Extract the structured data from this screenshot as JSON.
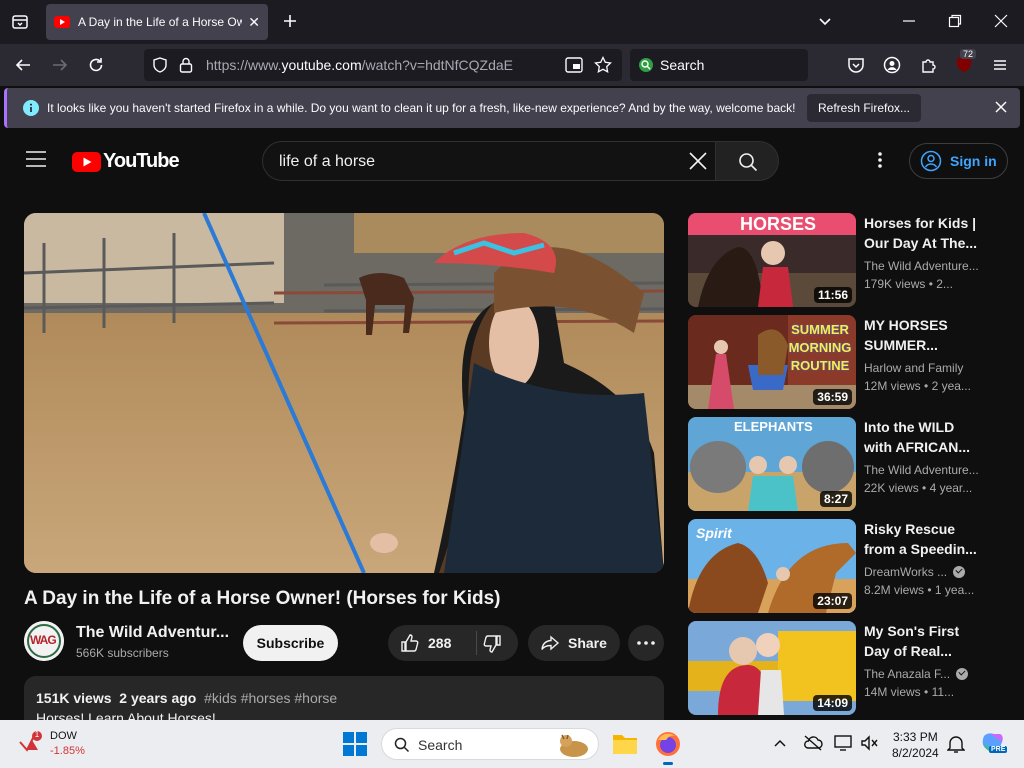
{
  "browser": {
    "tab_title": "A Day in the Life of a Horse Owner",
    "url_prefix": "https://www.",
    "url_host": "youtube.com",
    "url_rest": "/watch?v=hdtNfCQZdaE",
    "search_placeholder": "Search",
    "extensions_badge": "72"
  },
  "notification": {
    "message": "It looks like you haven't started Firefox in a while. Do you want to clean it up for a fresh, like-new experience? And by the way, welcome back!",
    "button": "Refresh Firefox..."
  },
  "youtube": {
    "logo_text": "YouTube",
    "search_query": "life of a horse",
    "signin": "Sign in"
  },
  "video": {
    "title": "A Day in the Life of a Horse Owner! (Horses for Kids)",
    "channel": "The Wild Adventur...",
    "subscribers": "566K subscribers",
    "avatar_text": "WAG",
    "subscribe": "Subscribe",
    "likes": "288",
    "share": "Share",
    "views": "151K views",
    "age": "2 years ago",
    "tags": "#kids #horses #horse",
    "description": "Horses!  Learn About Horses!"
  },
  "recommendations": [
    {
      "title1": "Horses for Kids |",
      "title2": "Our Day At The...",
      "channel": "The Wild Adventure...",
      "verified": false,
      "views": "179K views",
      "age": "2...",
      "duration": "11:56",
      "thumb_text": "HORSES"
    },
    {
      "title1": "MY HORSES",
      "title2": "SUMMER...",
      "channel": "Harlow and Family",
      "verified": false,
      "views": "12M views",
      "age": "2 yea...",
      "duration": "36:59",
      "thumb_text": "SUMMER MORNING ROUTINE"
    },
    {
      "title1": "Into the WILD",
      "title2": "with AFRICAN...",
      "channel": "The Wild Adventure...",
      "verified": false,
      "views": "22K views",
      "age": "4 year...",
      "duration": "8:27",
      "thumb_text": "ELEPHANTS"
    },
    {
      "title1": "Risky Rescue",
      "title2": "from a Speedin...",
      "channel": "DreamWorks ...",
      "verified": true,
      "views": "8.2M views",
      "age": "1 yea...",
      "duration": "23:07",
      "thumb_text": "Spirit"
    },
    {
      "title1": "My Son's First",
      "title2": "Day of Real...",
      "channel": "The Anazala F...",
      "verified": true,
      "views": "14M views",
      "age": "11...",
      "duration": "14:09",
      "thumb_text": ""
    }
  ],
  "taskbar": {
    "stock_name": "DOW",
    "stock_change": "-1.85%",
    "stock_badge": "1",
    "search": "Search",
    "time": "3:33 PM",
    "date": "8/2/2024"
  },
  "colors": {
    "yt_red": "#ff0000",
    "link_blue": "#3ea6ff",
    "firefox_accent": "#ab71ff"
  }
}
